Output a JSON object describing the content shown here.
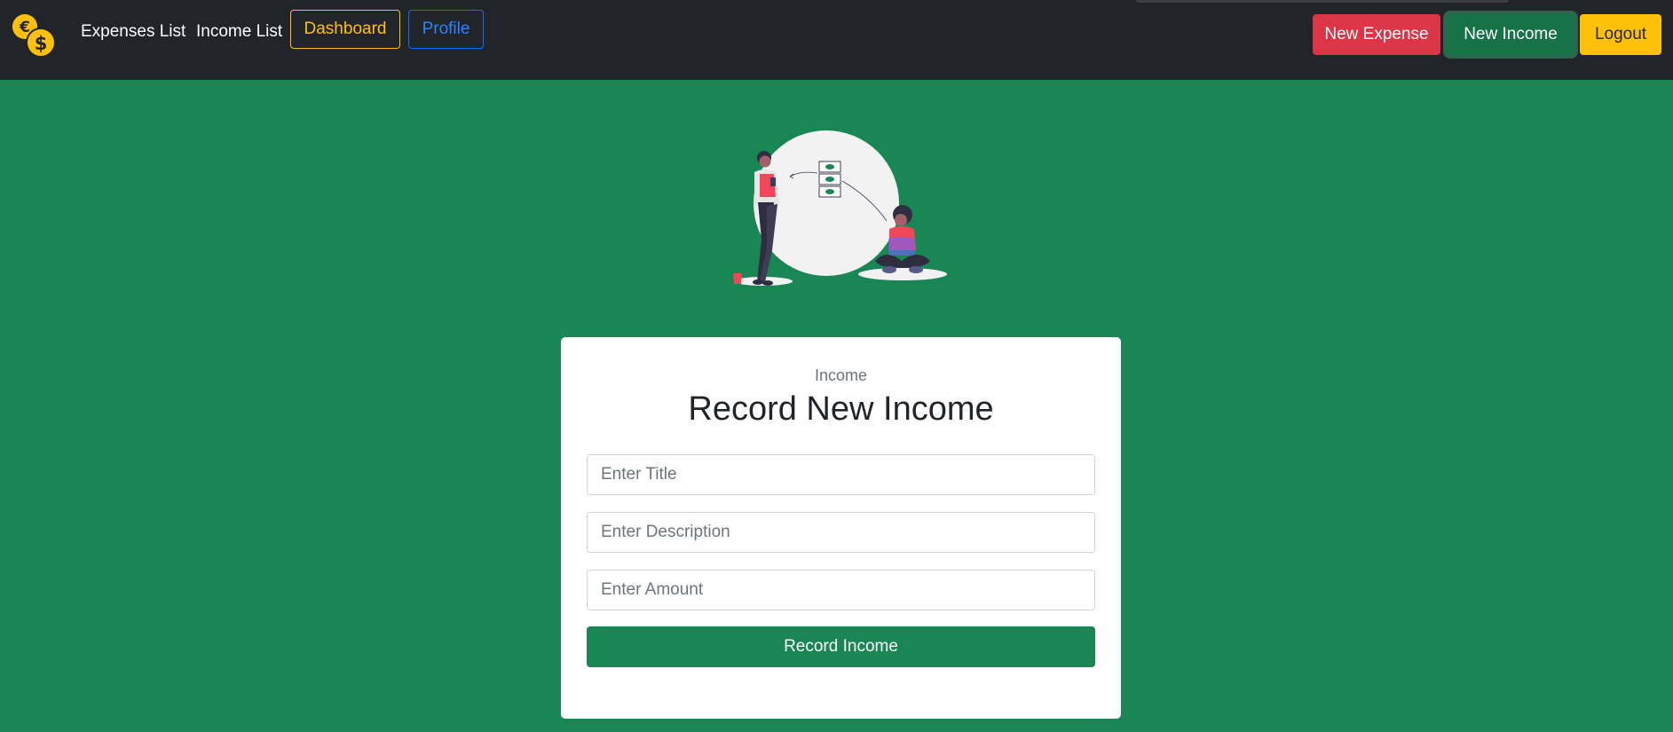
{
  "nav": {
    "logo_icon": "coins-euro-dollar-icon",
    "links": {
      "expenses_list": "Expenses List",
      "income_list": "Income List"
    },
    "dashboard_label": "Dashboard",
    "profile_label": "Profile",
    "new_expense_label": "New Expense",
    "new_income_label": "New Income",
    "logout_label": "Logout"
  },
  "illustration": {
    "icon": "money-transfer-illustration"
  },
  "form": {
    "subtitle": "Income",
    "title": "Record New Income",
    "title_placeholder": "Enter Title",
    "description_placeholder": "Enter Description",
    "amount_placeholder": "Enter Amount",
    "submit_label": "Record Income"
  },
  "colors": {
    "page_background": "#198754",
    "navbar": "#212529",
    "danger": "#dc3545",
    "success": "#198754",
    "warning": "#ffc107",
    "primary": "#0d6efd"
  }
}
